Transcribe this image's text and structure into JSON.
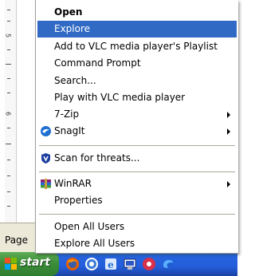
{
  "ruler": {
    "numbers": [
      "5",
      "6"
    ]
  },
  "status": {
    "text": "Page"
  },
  "taskbar": {
    "start_label": "start",
    "quick_launch_icons": [
      "firefox-icon",
      "browser-icon",
      "internet-explorer-icon",
      "show-desktop-icon",
      "media-icon",
      "messenger-icon"
    ]
  },
  "menu": {
    "items": [
      {
        "label": "Open"
      },
      {
        "label": "Explore"
      },
      {
        "label": "Add to VLC media player's Playlist"
      },
      {
        "label": "Command Prompt"
      },
      {
        "label": "Search..."
      },
      {
        "label": "Play with VLC media player"
      },
      {
        "label": "7-Zip"
      },
      {
        "label": "SnagIt"
      },
      {
        "label": "Scan for threats..."
      },
      {
        "label": "WinRAR"
      },
      {
        "label": "Properties"
      },
      {
        "label": "Open All Users"
      },
      {
        "label": "Explore All Users"
      }
    ]
  },
  "colors": {
    "selection": "#316ac5",
    "taskbar": "#245edb",
    "start_button": "#3c8f3a"
  }
}
